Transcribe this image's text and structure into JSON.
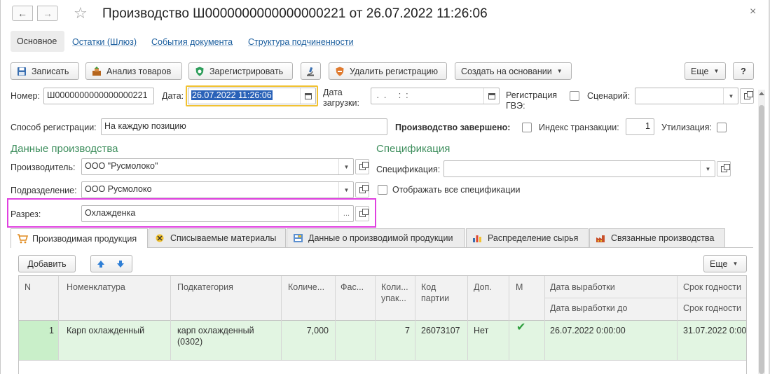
{
  "window": {
    "title": "Производство Ш0000000000000000221 от 26.07.2022 11:26:06",
    "close_glyph": "×"
  },
  "top_tabs": [
    {
      "label": "Основное"
    },
    {
      "label": "Остатки (Шлюз)"
    },
    {
      "label": "События документа"
    },
    {
      "label": "Структура подчиненности"
    }
  ],
  "toolbar": {
    "save": "Записать",
    "analyze": "Анализ товаров",
    "register": "Зарегистрировать",
    "delete_reg": "Удалить регистрацию",
    "create_based": "Создать на основании",
    "more": "Еще",
    "help": "?"
  },
  "header": {
    "number_label": "Номер:",
    "number_value": "Ш0000000000000000221",
    "date_label": "Дата:",
    "date_value": "26.07.2022 11:26:06",
    "load_date_label_1": "Дата",
    "load_date_label_2": "загрузки:",
    "load_date_value": " .  .     :  :",
    "gve_label_1": "Регистрация",
    "gve_label_2": "ГВЭ:",
    "scenario_label": "Сценарий:",
    "scenario_value": ""
  },
  "row2": {
    "reg_method_label": "Способ регистрации:",
    "reg_method_value": "На каждую позицию",
    "finished_label": "Производство завершено:",
    "tx_index_label": "Индекс транзакции:",
    "tx_index_value": "1",
    "utilization_label": "Утилизация:"
  },
  "production": {
    "section_title": "Данные производства",
    "producer_label": "Производитель:",
    "producer_value": "ООО \"Русмолоко\"",
    "division_label": "Подразделение:",
    "division_value": "ООО Русмолоко",
    "cut_label": "Разрез:",
    "cut_value": "Охлажденка",
    "cut_select": "..."
  },
  "spec": {
    "section_title": "Спецификация",
    "spec_label": "Спецификация:",
    "spec_value": "",
    "show_all_label": "Отображать все спецификации"
  },
  "tabs": [
    {
      "label": "Производимая продукция"
    },
    {
      "label": "Списываемые материалы"
    },
    {
      "label": "Данные о производимой продукции"
    },
    {
      "label": "Распределение сырья"
    },
    {
      "label": "Связанные производства"
    }
  ],
  "table_toolbar": {
    "add": "Добавить",
    "more": "Еще"
  },
  "table": {
    "headers": {
      "n": "N",
      "nomenclature": "Номенклатура",
      "subcategory": "Подкатегория",
      "qty": "Количе...",
      "packing": "Фас...",
      "qty_pack_1": "Коли...",
      "qty_pack_2": "упак...",
      "batch_1": "Код",
      "batch_2": "партии",
      "extra": "Доп.",
      "m": "М",
      "prod_date": "Дата выработки",
      "prod_date_to": "Дата выработки до",
      "expiry": "Срок годности",
      "expiry_to": "Срок годности"
    },
    "rows": [
      {
        "n": "1",
        "nomenclature": "Карп охлажденный",
        "subcategory_1": "карп охлажденный",
        "subcategory_2": "(0302)",
        "qty": "7,000",
        "packing": "",
        "qty_pack": "7",
        "batch": "26073107",
        "extra": "Нет",
        "m_check": "✔",
        "prod_date": "26.07.2022 0:00:00",
        "expiry": "31.07.2022 0:00"
      }
    ]
  },
  "colors": {
    "accent_green": "#3f8f5e",
    "link_blue": "#1b5e9e",
    "highlight_magenta": "#e040e0",
    "selected_row": "#e2f5e2",
    "date_focus": "#f1c232"
  }
}
